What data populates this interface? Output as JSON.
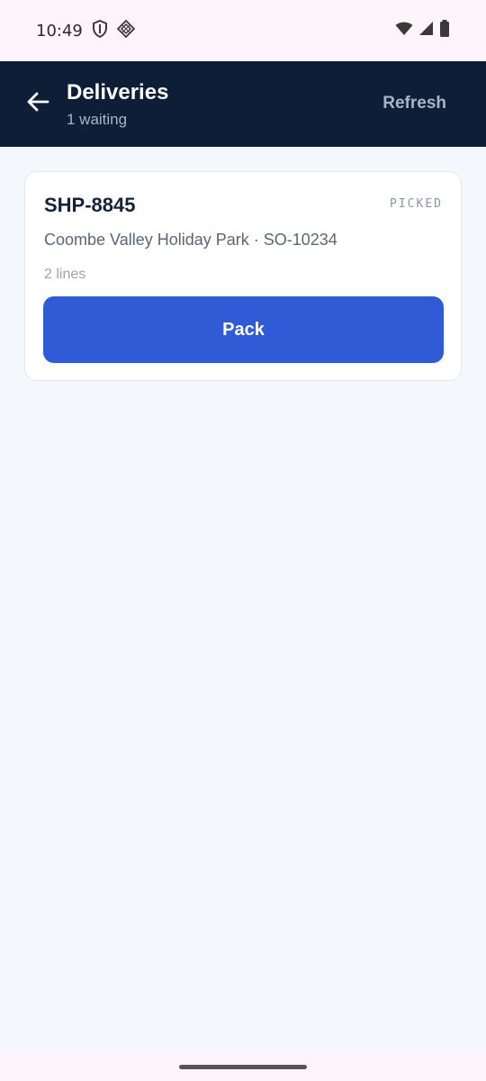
{
  "status_bar": {
    "time": "10:49",
    "icons": [
      "shield-icon",
      "vpn-diamond-icon",
      "wifi-icon",
      "signal-icon",
      "battery-icon"
    ]
  },
  "app_bar": {
    "title": "Deliveries",
    "subtitle": "1 waiting",
    "refresh_label": "Refresh",
    "back_icon": "arrow-left-icon"
  },
  "deliveries": [
    {
      "id": "SHP-8845",
      "status": "PICKED",
      "description": "Coombe Valley Holiday Park · SO-10234",
      "lines": "2 lines",
      "action_label": "Pack"
    }
  ],
  "colors": {
    "app_bar_bg": "#0e1e36",
    "primary_button": "#2f5cd6",
    "content_bg": "#f4f7fb",
    "status_bar_bg": "#fdf5fb"
  }
}
